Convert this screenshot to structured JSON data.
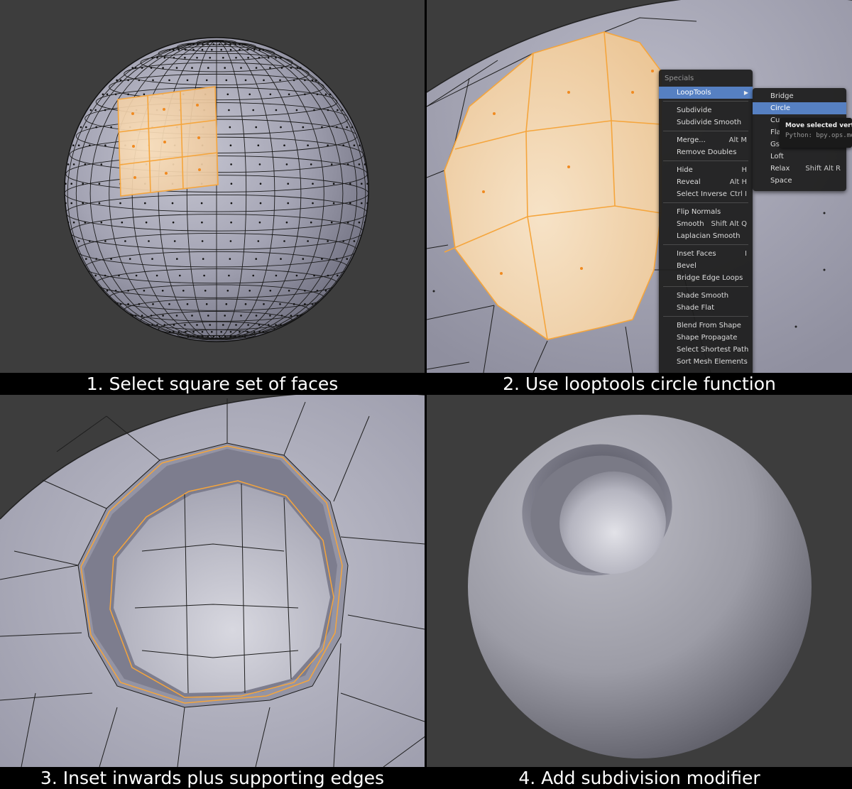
{
  "captions": {
    "step1": "1. Select square set of faces",
    "step2": "2. Use looptools circle function",
    "step3": "3. Inset inwards plus supporting edges",
    "step4": "4. Add subdivision modifier"
  },
  "specials_menu": {
    "title": "Specials",
    "items": [
      {
        "label": "LoopTools",
        "shortcut": "",
        "highlighted": true,
        "submenu": true
      },
      {
        "sep": true
      },
      {
        "label": "Subdivide",
        "shortcut": ""
      },
      {
        "label": "Subdivide Smooth",
        "shortcut": ""
      },
      {
        "sep": true
      },
      {
        "label": "Merge...",
        "shortcut": "Alt M"
      },
      {
        "label": "Remove Doubles",
        "shortcut": ""
      },
      {
        "sep": true
      },
      {
        "label": "Hide",
        "shortcut": "H"
      },
      {
        "label": "Reveal",
        "shortcut": "Alt H"
      },
      {
        "label": "Select Inverse",
        "shortcut": "Ctrl I"
      },
      {
        "sep": true
      },
      {
        "label": "Flip Normals",
        "shortcut": ""
      },
      {
        "label": "Smooth",
        "shortcut": "Shift Alt Q"
      },
      {
        "label": "Laplacian Smooth",
        "shortcut": ""
      },
      {
        "sep": true
      },
      {
        "label": "Inset Faces",
        "shortcut": "I"
      },
      {
        "label": "Bevel",
        "shortcut": ""
      },
      {
        "label": "Bridge Edge Loops",
        "shortcut": ""
      },
      {
        "sep": true
      },
      {
        "label": "Shade Smooth",
        "shortcut": ""
      },
      {
        "label": "Shade Flat",
        "shortcut": ""
      },
      {
        "sep": true
      },
      {
        "label": "Blend From Shape",
        "shortcut": ""
      },
      {
        "label": "Shape Propagate",
        "shortcut": ""
      },
      {
        "label": "Select Shortest Path",
        "shortcut": ""
      },
      {
        "label": "Sort Mesh Elements",
        "shortcut": ""
      }
    ]
  },
  "looptools_submenu": {
    "items": [
      {
        "label": "Bridge",
        "shortcut": ""
      },
      {
        "label": "Circle",
        "shortcut": "",
        "highlighted": true
      },
      {
        "label": "Curve",
        "shortcut": ""
      },
      {
        "label": "Flatten",
        "shortcut": ""
      },
      {
        "label": "Gstretch",
        "shortcut": ""
      },
      {
        "label": "Loft",
        "shortcut": ""
      },
      {
        "label": "Relax",
        "shortcut": "Shift Alt R"
      },
      {
        "label": "Space",
        "shortcut": ""
      }
    ]
  },
  "tooltip": {
    "title": "Move selected vertices into a circle shape",
    "python": "Python: bpy.ops.mesh.looptools_circle()"
  },
  "colors": {
    "viewport_bg": "#3d3d3d",
    "mesh_gray": "#a4a4b4",
    "selection_orange": "#f5a53c",
    "menu_highlight": "#5680c2"
  }
}
